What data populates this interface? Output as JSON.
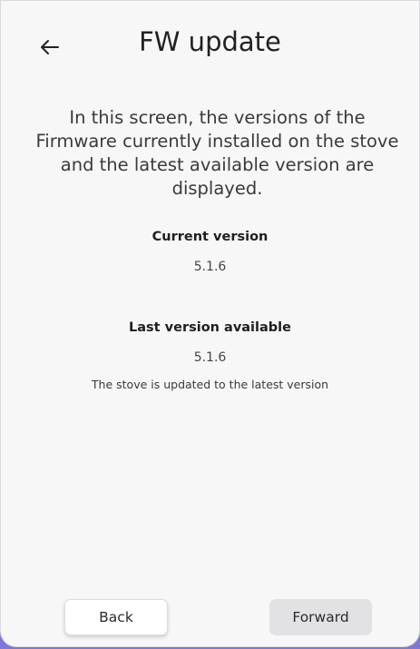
{
  "header": {
    "title": "FW update",
    "back_icon": "arrow-left-icon"
  },
  "intro": {
    "text": "In this screen, the versions of the Firmware currently installed on the stove and the latest available version are displayed."
  },
  "current": {
    "label": "Current version",
    "value": "5.1.6"
  },
  "latest": {
    "label": "Last version available",
    "value": "5.1.6"
  },
  "status": {
    "text": "The stove is updated to the latest version"
  },
  "footer": {
    "back_label": "Back",
    "forward_label": "Forward"
  },
  "colors": {
    "frame_accent": "#7e78d6",
    "screen_bg": "#f7f7f8",
    "forward_button_bg": "#e2e2e4"
  }
}
